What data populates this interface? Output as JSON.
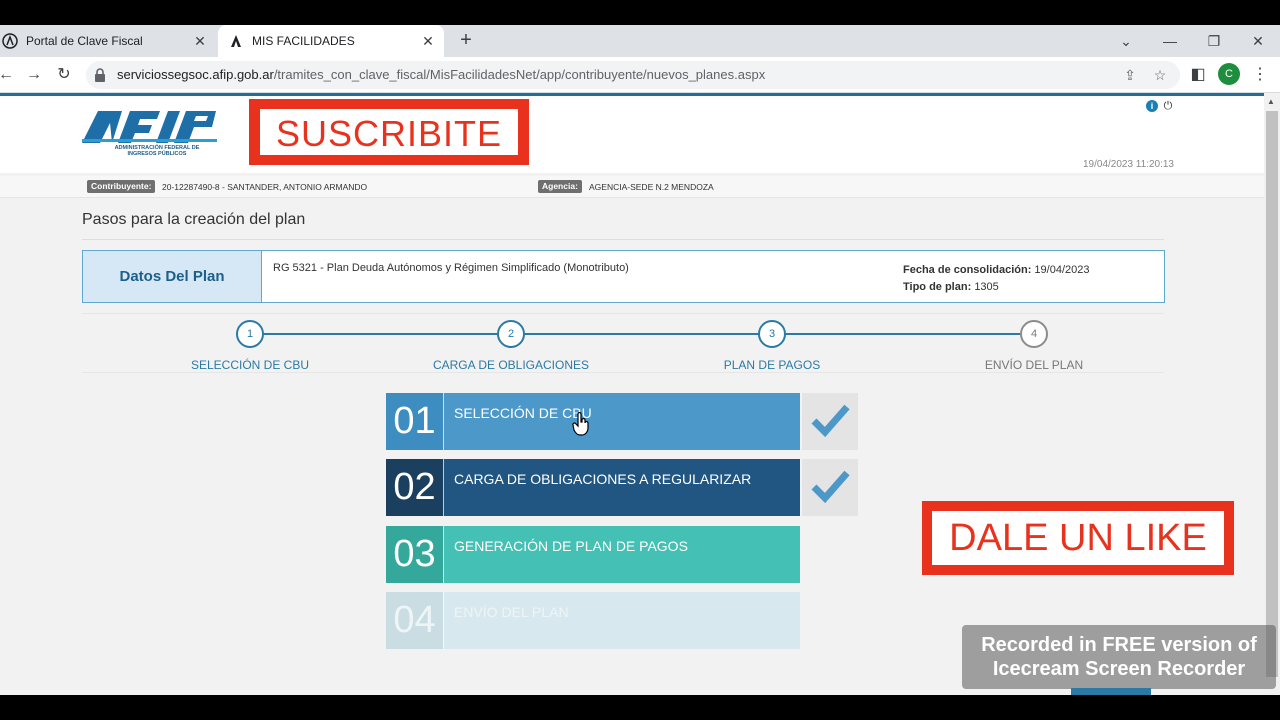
{
  "browser": {
    "tabs": [
      {
        "title": "Portal de Clave Fiscal",
        "active": false
      },
      {
        "title": "MIS FACILIDADES",
        "active": true
      }
    ],
    "url_host": "serviciossegsoc.afip.gob.ar",
    "url_path": "/tramites_con_clave_fiscal/MisFacilidadesNet/app/contribuyente/nuevos_planes.aspx",
    "profile_initial": "C"
  },
  "header": {
    "logo_text": "AFIP",
    "logo_sub": "ADMINISTRACIÓN FEDERAL DE INGRESOS PÚBLICOS",
    "subscribe_text": "SUSCRIBITE",
    "datetime": "19/04/2023 11:20:13"
  },
  "infobar": {
    "contribuyente_label": "Contribuyente:",
    "contribuyente_value": "20-12287490-8 - SANTANDER, ANTONIO ARMANDO",
    "agencia_label": "Agencia:",
    "agencia_value": "AGENCIA-SEDE N.2 MENDOZA"
  },
  "main": {
    "title": "Pasos para la creación del plan",
    "plan": {
      "label": "Datos Del Plan",
      "description": "RG 5321 - Plan Deuda Autónomos y Régimen Simplificado (Monotributo)",
      "fecha_label": "Fecha de consolidación:",
      "fecha_value": "19/04/2023",
      "tipo_label": "Tipo de plan:",
      "tipo_value": "1305"
    },
    "steps": [
      {
        "number": "1",
        "label": "SELECCIÓN DE CBU"
      },
      {
        "number": "2",
        "label": "CARGA DE OBLIGACIONES"
      },
      {
        "number": "3",
        "label": "PLAN DE PAGOS"
      },
      {
        "number": "4",
        "label": "ENVÍO DEL PLAN"
      }
    ],
    "cards": [
      {
        "number": "01",
        "label": "SELECCIÓN DE CBU",
        "done": true,
        "num_color": "#3d8dc0",
        "bg_color": "#4b98c9"
      },
      {
        "number": "02",
        "label": "CARGA DE OBLIGACIONES A REGULARIZAR",
        "done": true,
        "num_color": "#1b3f5e",
        "bg_color": "#215683"
      },
      {
        "number": "03",
        "label": "GENERACIÓN DE PLAN DE PAGOS",
        "done": false,
        "num_color": "#35a89c",
        "bg_color": "#45c0b4"
      },
      {
        "number": "04",
        "label": "ENVÍO DEL PLAN",
        "done": false,
        "num_color": "#c9dde3",
        "bg_color": "#d7e9ee"
      }
    ]
  },
  "overlay": {
    "like_text": "DALE UN LIKE",
    "watermark_line1": "Recorded in FREE version of",
    "watermark_line2": "Icecream Screen Recorder"
  }
}
